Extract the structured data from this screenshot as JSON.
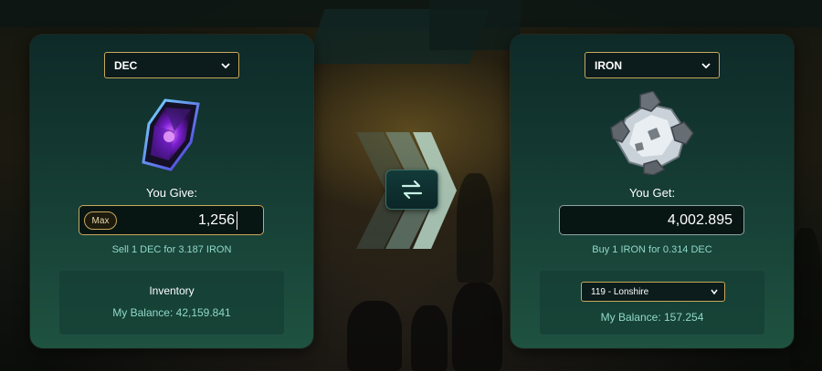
{
  "give_panel": {
    "token_select": "DEC",
    "token_icon": "dec-crystal-icon",
    "label": "You Give:",
    "max_label": "Max",
    "amount": "1,256",
    "rate_text": "Sell 1 DEC for 3.187 IRON",
    "inventory_title": "Inventory",
    "balance_text": "My Balance: 42,159.841"
  },
  "get_panel": {
    "token_select": "IRON",
    "token_icon": "iron-ore-icon",
    "label": "You Get:",
    "amount": "4,002.895",
    "rate_text": "Buy 1 IRON for 0.314 DEC",
    "region_select": "119 - Lonshire",
    "balance_text": "My Balance: 157.254"
  },
  "swap_button_icon": "swap-arrows-icon",
  "colors": {
    "accent_gold": "#c9a85a",
    "rate_teal": "#8fd9c9",
    "panel_top": "#0e2a28",
    "panel_bottom": "#1f5240"
  }
}
